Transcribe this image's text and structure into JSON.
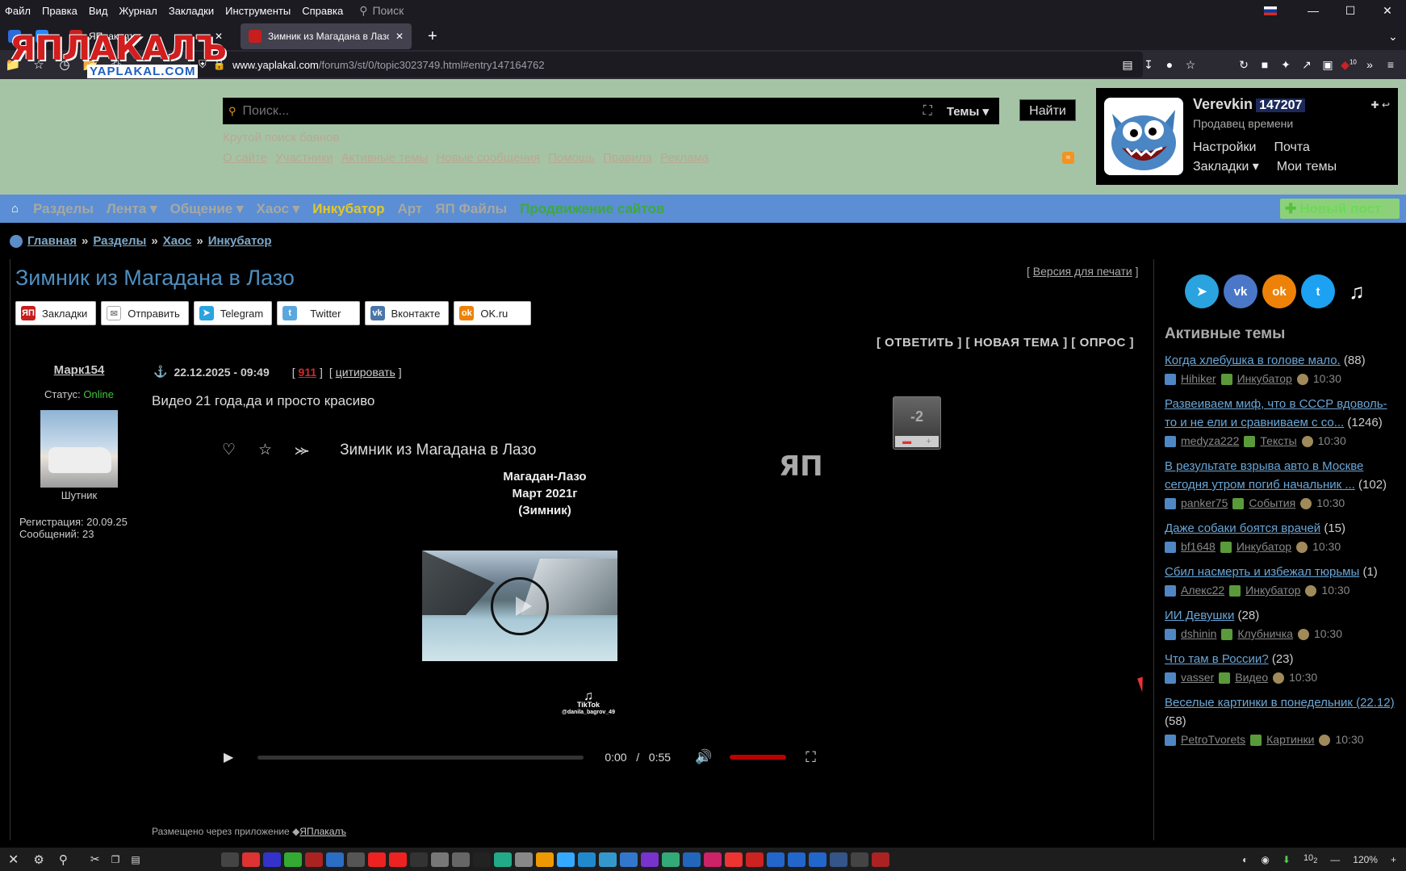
{
  "browser": {
    "menu": [
      "Файл",
      "Правка",
      "Вид",
      "Журнал",
      "Закладки",
      "Инструменты",
      "Справка"
    ],
    "search_placeholder": "Поиск",
    "tabs": [
      {
        "title": "ЯПлакалъ"
      },
      {
        "title": "Зимник из Магадана в Лазо - Я"
      }
    ],
    "url_domain": "www.yaplakal.com",
    "url_path": "/forum3/st/0/topic3023749.html#entry147164762",
    "badge": "10",
    "zoom": "120%"
  },
  "header": {
    "logo_main": "ЯПЛАКАЛЪ",
    "logo_sub": "YAPLAKAL.COM",
    "search_placeholder": "Поиск...",
    "topics_select": "Темы",
    "find_button": "Найти",
    "tagline": "Крутой поиск баянов",
    "links": [
      "О сайте",
      "Участники",
      "Активные темы",
      "Новые сообщения",
      "Помощь",
      "Правила",
      "Реклама"
    ]
  },
  "user": {
    "name": "Verevkin",
    "id": "147207",
    "title": "Продавец времени",
    "settings": "Настройки",
    "mail": "Почта",
    "bookmarks": "Закладки",
    "my_topics": "Мои темы"
  },
  "nav": {
    "items": [
      "Разделы",
      "Лента",
      "Общение",
      "Хаос"
    ],
    "incubator": "Инкубатор",
    "art": "Арт",
    "files": "ЯП Файлы",
    "promo": "Продвижение сайтов",
    "new_post": "Новый пост"
  },
  "breadcrumb": [
    "Главная",
    "Разделы",
    "Хаос",
    "Инкубатор"
  ],
  "topic": {
    "title": "Зимник из Магадана в Лазо",
    "print_version": "Версия для печати",
    "share": [
      "Закладки",
      "Отправить",
      "Telegram",
      "Twitter",
      "Вконтакте",
      "OK.ru"
    ],
    "reply_bar": "[ ОТВЕТИТЬ ] [ НОВАЯ ТЕМА ] [ ОПРОС ]"
  },
  "post": {
    "author": "Марк154",
    "status_label": "Статус:",
    "status": "Online",
    "rank": "Шутник",
    "registration": "Регистрация: 20.09.25",
    "messages": "Сообщений: 23",
    "date": "22.12.2025 - 09:49",
    "number": "911",
    "quote": "цитировать",
    "text": "Видео 21 года,да и просто красиво",
    "rating": "-2",
    "placed_via": "Размещено через приложение",
    "app": "ЯПлакалъ"
  },
  "video": {
    "title": "Зимник из Магадана в Лазо",
    "caption_line1": "Магадан-Лазо",
    "caption_line2": "Март 2021г",
    "caption_line3": "(Зимник)",
    "tiktok_label": "TikTok",
    "tiktok_user": "@danila_bagrov_49",
    "current_time": "0:00",
    "separator": "/",
    "duration": "0:55",
    "watermark": "ЯП"
  },
  "sidebar": {
    "title": "Активные темы",
    "items": [
      {
        "title": "Когда хлебушка в голове мало.",
        "count": "(88)",
        "user": "Hihiker",
        "section": "Инкубатор",
        "time": "10:30"
      },
      {
        "title": "Развеиваем миф, что в СССР вдоволь-то и не ели и сравниваем с со...",
        "count": "(1246)",
        "user": "medyza222",
        "section": "Тексты",
        "time": "10:30"
      },
      {
        "title": "В результате взрыва авто в Москве сегодня утром погиб начальник ...",
        "count": "(102)",
        "user": "panker75",
        "section": "События",
        "time": "10:30"
      },
      {
        "title": "Даже собаки боятся врачей",
        "count": "(15)",
        "user": "bf1648",
        "section": "Инкубатор",
        "time": "10:30"
      },
      {
        "title": "Сбил насмерть и избежал тюрьмы",
        "count": "(1)",
        "user": "Алекс22",
        "section": "Инкубатор",
        "time": "10:30"
      },
      {
        "title": "ИИ Девушки",
        "count": "(28)",
        "user": "dshinin",
        "section": "Клубничка",
        "time": "10:30"
      },
      {
        "title": "Что там в России?",
        "count": "(23)",
        "user": "vasser",
        "section": "Видео",
        "time": "10:30"
      },
      {
        "title": "Веселые картинки в понедельник (22.12)",
        "count": "(58)",
        "user": "PetroTvorets",
        "section": "Картинки",
        "time": "10:30"
      }
    ]
  },
  "taskbar": {
    "clock_a": "10",
    "clock_b": "2"
  }
}
